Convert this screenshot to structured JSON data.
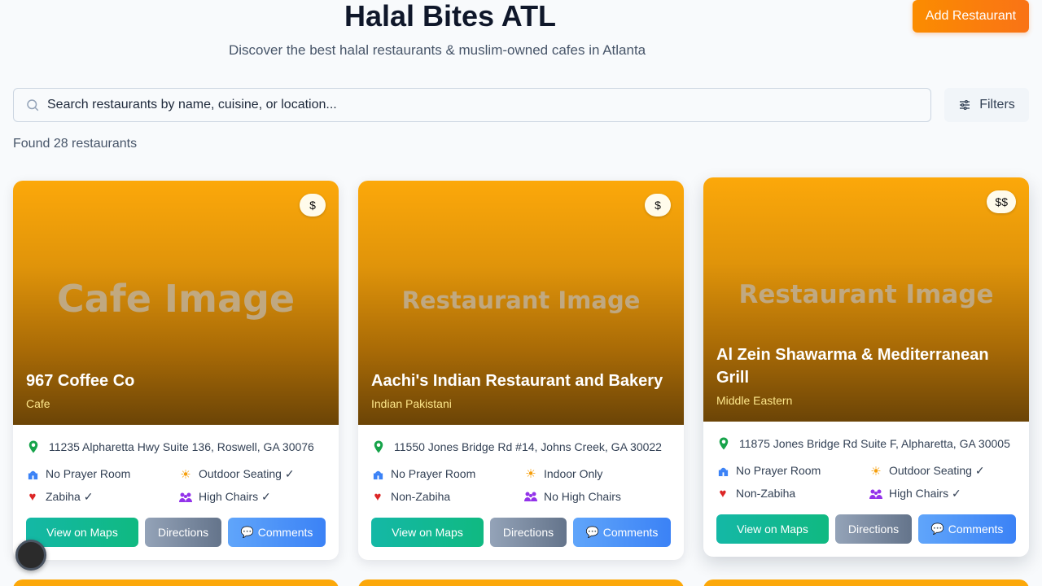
{
  "header": {
    "title": "Halal Bites ATL",
    "subtitle": "Discover the best halal restaurants & muslim-owned cafes in Atlanta",
    "add_label": "Add Restaurant"
  },
  "search": {
    "placeholder": "Search restaurants by name, cuisine, or location...",
    "filters_label": "Filters"
  },
  "results": {
    "found_text": "Found 28 restaurants"
  },
  "colors": {
    "accent": "#f97316",
    "maps": "#10b981",
    "directions": "#64748b",
    "comments": "#3b82f6"
  },
  "cards": [
    {
      "image_text": "Cafe Image",
      "price": "$",
      "name": "967 Coffee Co",
      "cuisine": "Cafe",
      "address": "11235 Alpharetta Hwy Suite 136, Roswell, GA 30076",
      "prayer": "No Prayer Room",
      "seating": "Outdoor Seating ✓",
      "zabiha": "Zabiha ✓",
      "chairs": "High Chairs ✓",
      "maps_label": "View on Maps",
      "directions_label": "Directions",
      "comments_label": "Comments"
    },
    {
      "image_text": "Restaurant Image",
      "price": "$",
      "name": "Aachi's Indian Restaurant and Bakery",
      "cuisine": "Indian Pakistani",
      "address": "11550 Jones Bridge Rd #14, Johns Creek, GA 30022",
      "prayer": "No Prayer Room",
      "seating": "Indoor Only",
      "zabiha": "Non-Zabiha",
      "chairs": "No High Chairs",
      "maps_label": "View on Maps",
      "directions_label": "Directions",
      "comments_label": "Comments"
    },
    {
      "image_text": "Restaurant Image",
      "price": "$$",
      "name": "Al Zein Shawarma & Mediterranean Grill",
      "cuisine": "Middle Eastern",
      "address": "11875 Jones Bridge Rd Suite F, Alpharetta, GA 30005",
      "prayer": "No Prayer Room",
      "seating": "Outdoor Seating ✓",
      "zabiha": "Non-Zabiha",
      "chairs": "High Chairs ✓",
      "maps_label": "View on Maps",
      "directions_label": "Directions",
      "comments_label": "Comments"
    }
  ]
}
